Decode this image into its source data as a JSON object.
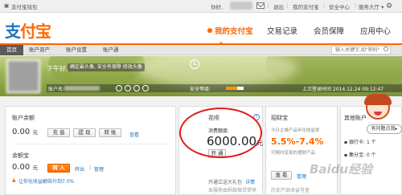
{
  "topbar": {
    "site_label": "支付宝钱包",
    "greeting": "你好,",
    "exit": "退出",
    "my_alipay": "我的支付宝",
    "security_center": "安全中心",
    "service_center": "服务大厅"
  },
  "header": {
    "logo_pay": "支",
    "logo_rest": "付宝",
    "nav": [
      "我的支付宝",
      "交易记录",
      "会员保障",
      "应用中心"
    ]
  },
  "tabs": {
    "items": [
      "首页",
      "账户资产",
      "账户设置",
      "账户通"
    ],
    "search_placeholder": "输入关键字,如\"密码\""
  },
  "banner": {
    "greeting": "下午好,",
    "tip": "确定最头像, 安全有保障 修改头像",
    "account_label": "账户名:",
    "security_label": "安全等级:",
    "last_login": "上次登录时间 2014.12.24 09:12:47",
    "security_level_fraction": 0.65
  },
  "balance": {
    "title": "账户余额",
    "amount": "0.00",
    "unit": "元",
    "recharge": "充 值",
    "withdraw": "提 现",
    "transfer": "转 账",
    "view": "查看"
  },
  "yuebao": {
    "title": "余额宝",
    "amount": "0.00",
    "unit": "元",
    "transfer_in": "转 入",
    "transfer_out": "转出",
    "manage": "管理",
    "promo": "让你化收益翻倍升到7.0%"
  },
  "huabei": {
    "title": "花呗",
    "limit_label": "消费额度:",
    "limit": "6000.00",
    "unit": "元",
    "open": "开 通",
    "footer_open": "开通立送大礼包",
    "footer_detail": "详情",
    "footer_note": "本服务由蚂蚁微贷提供"
  },
  "zhaocaibao": {
    "title": "招财宝",
    "desc": "今日主推产品年化收益率",
    "rate": "5.5%-7.4%",
    "sub": "可随时变现的理财产品",
    "view": "查 看",
    "manage": "管理",
    "history": "历史产品收益可查"
  },
  "other_assets": {
    "title": "其他账户",
    "bank_card": "银行卡:",
    "bank_card_count": "1 个",
    "points": "集分宝:",
    "points_count": "0 个"
  },
  "help_bubble": "有问题点我▸",
  "watermark": "Baidu经验"
}
